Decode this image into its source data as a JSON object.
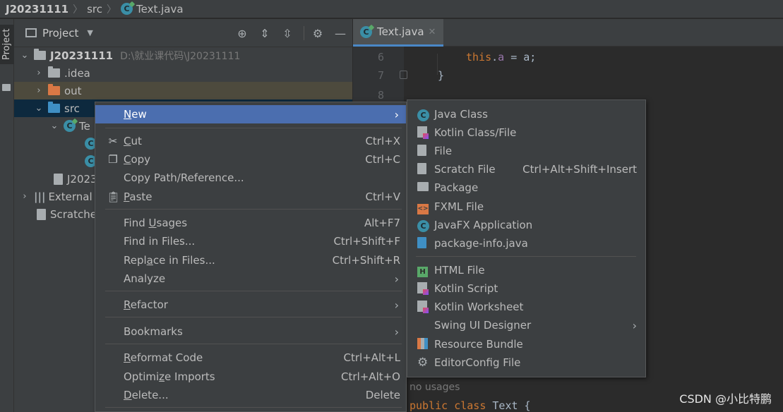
{
  "breadcrumb": {
    "project": "J20231111",
    "folder": "src",
    "file": "Text.java"
  },
  "left_strip": {
    "tab_label": "Project"
  },
  "project_panel": {
    "title": "Project",
    "tree": [
      {
        "label": "J20231111",
        "path": "D:\\就业课代码\\J20231111"
      },
      {
        "label": ".idea"
      },
      {
        "label": "out"
      },
      {
        "label": "src"
      },
      {
        "label": "Te"
      },
      {
        "label": ""
      },
      {
        "label": ""
      },
      {
        "label": "J2023"
      },
      {
        "label": "External"
      },
      {
        "label": "Scratche"
      }
    ]
  },
  "editor": {
    "tab_label": "Text.java",
    "line_numbers": [
      "6",
      "7",
      "8"
    ],
    "code_line_6": {
      "kw": "this",
      "dot": ".",
      "field": "a",
      "rest": " = a;"
    },
    "code_line_7": "}",
    "usage_hint": "no usages",
    "bottom_code": {
      "kw1": "public",
      "kw2": "class",
      "name": "Text",
      "brace": " {"
    }
  },
  "context_menu": {
    "items": [
      {
        "label_u": "N",
        "label_rest": "ew",
        "shortcut": ""
      },
      {
        "label_u": "C",
        "label_rest": "ut",
        "label_pre": "",
        "shortcut": "Ctrl+X"
      },
      {
        "label_u": "C",
        "label_rest": "opy",
        "shortcut": "Ctrl+C"
      },
      {
        "label": "Copy Path/Reference...",
        "shortcut": ""
      },
      {
        "label_u": "P",
        "label_rest": "aste",
        "shortcut": "Ctrl+V"
      },
      {
        "label_pre": "Find ",
        "label_u": "U",
        "label_rest": "sages",
        "shortcut": "Alt+F7"
      },
      {
        "label": "Find in Files...",
        "shortcut": "Ctrl+Shift+F"
      },
      {
        "label_pre": "Repl",
        "label_u": "a",
        "label_rest": "ce in Files...",
        "shortcut": "Ctrl+Shift+R"
      },
      {
        "label": "Analyze",
        "shortcut": ""
      },
      {
        "label_u": "R",
        "label_rest": "efactor",
        "shortcut": ""
      },
      {
        "label": "Bookmarks",
        "shortcut": ""
      },
      {
        "label_u": "R",
        "label_rest": "eformat Code",
        "shortcut": "Ctrl+Alt+L"
      },
      {
        "label_pre": "Optimi",
        "label_u": "z",
        "label_rest": "e Imports",
        "shortcut": "Ctrl+Alt+O"
      },
      {
        "label_u": "D",
        "label_rest": "elete...",
        "shortcut": "Delete"
      }
    ]
  },
  "submenu": {
    "items": [
      {
        "label": "Java Class",
        "shortcut": ""
      },
      {
        "label": "Kotlin Class/File",
        "shortcut": ""
      },
      {
        "label": "File",
        "shortcut": ""
      },
      {
        "label": "Scratch File",
        "shortcut": "Ctrl+Alt+Shift+Insert"
      },
      {
        "label": "Package",
        "shortcut": ""
      },
      {
        "label": "FXML File",
        "shortcut": ""
      },
      {
        "label": "JavaFX Application",
        "shortcut": ""
      },
      {
        "label": "package-info.java",
        "shortcut": ""
      },
      {
        "label": "HTML File",
        "shortcut": ""
      },
      {
        "label": "Kotlin Script",
        "shortcut": ""
      },
      {
        "label": "Kotlin Worksheet",
        "shortcut": ""
      },
      {
        "label": "Swing UI Designer",
        "shortcut": ""
      },
      {
        "label": "Resource Bundle",
        "shortcut": ""
      },
      {
        "label": "EditorConfig File",
        "shortcut": ""
      }
    ]
  },
  "watermark": "CSDN @小比特鹏",
  "colors": {
    "selection": "#4b6eaf",
    "background": "#2b2b2b",
    "panel": "#3c3f41"
  }
}
